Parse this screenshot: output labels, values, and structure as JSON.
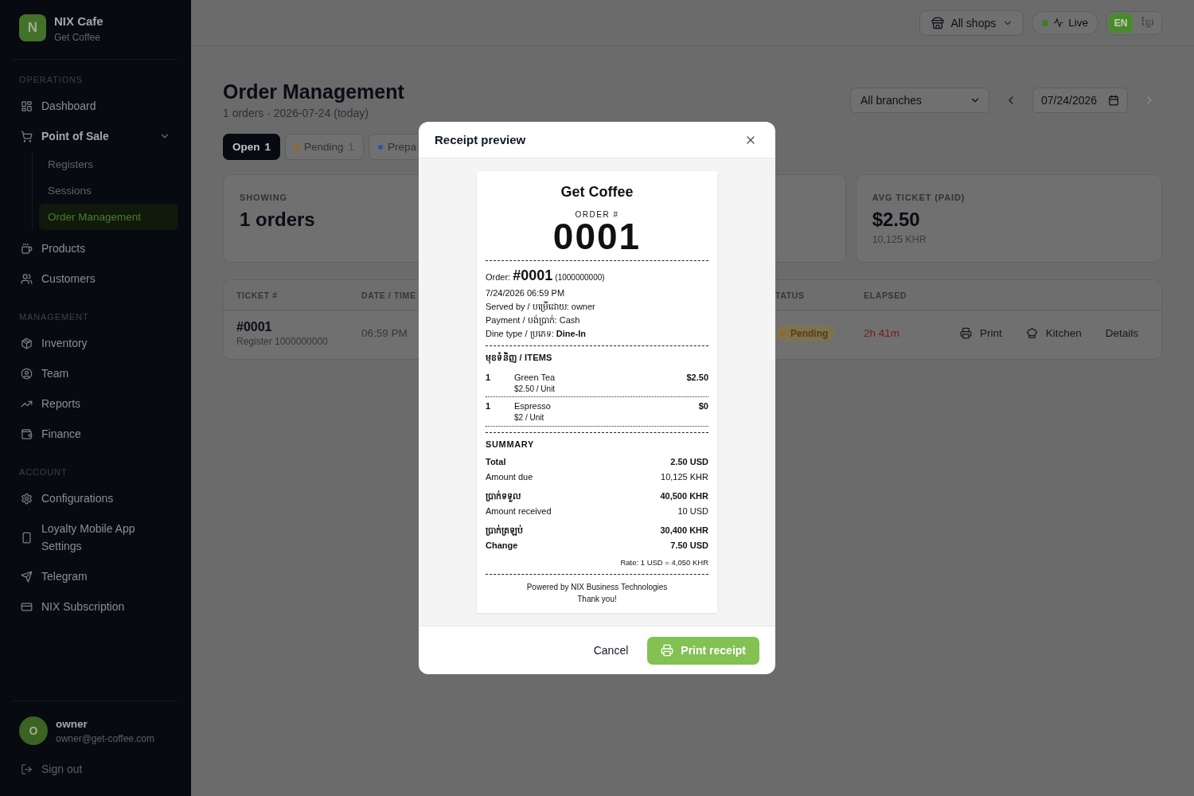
{
  "sidebar": {
    "brand": {
      "initial": "N",
      "name": "NIX Cafe",
      "subtitle": "Get Coffee"
    },
    "sections": [
      {
        "title": "OPERATIONS",
        "items": [
          {
            "label": "Dashboard",
            "selected": false
          },
          {
            "label": "Point of Sale",
            "selected": false,
            "expanded": true,
            "children": [
              {
                "label": "Registers",
                "selected": false
              },
              {
                "label": "Sessions",
                "selected": false
              },
              {
                "label": "Order Management",
                "selected": true
              }
            ]
          },
          {
            "label": "Products",
            "selected": false
          },
          {
            "label": "Customers",
            "selected": false
          }
        ]
      },
      {
        "title": "MANAGEMENT",
        "items": [
          {
            "label": "Inventory",
            "selected": false
          },
          {
            "label": "Team",
            "selected": false
          },
          {
            "label": "Reports",
            "selected": false
          },
          {
            "label": "Finance",
            "selected": false
          }
        ]
      },
      {
        "title": "ACCOUNT",
        "items": [
          {
            "label": "Configurations",
            "selected": false
          },
          {
            "label": "Loyalty Mobile App Settings",
            "selected": false
          },
          {
            "label": "Telegram",
            "selected": false
          },
          {
            "label": "NIX Subscription",
            "selected": false
          }
        ]
      }
    ],
    "user": {
      "initial": "O",
      "name": "owner",
      "email": "owner@get-coffee.com"
    },
    "sign_out": "Sign out"
  },
  "topbar": {
    "shop_selector": "All shops",
    "live": {
      "label": "Live",
      "on": true
    },
    "languages": [
      {
        "label": "EN",
        "selected": true
      },
      {
        "label": "ខ្មែរ",
        "selected": false
      }
    ]
  },
  "page": {
    "title": "Order Management",
    "subtitle": "1 orders · 2026-07-24 (today)",
    "branch_select": "All branches",
    "date": "07/24/2026",
    "prev_day": {
      "disabled": false
    },
    "next_day": {
      "disabled": true
    }
  },
  "tabs": [
    {
      "label": "Open",
      "count": "1",
      "selected": true
    },
    {
      "label": "Pending",
      "count": "1",
      "selected": false,
      "color": "#a0660f"
    },
    {
      "label": "Prepa",
      "selected": false,
      "color": "#2b55a6"
    }
  ],
  "stat_cards": [
    {
      "label": "SHOWING",
      "value": "1 orders"
    },
    {
      "label": "AVG TICKET (PAID)",
      "value": "$2.50",
      "sub": "10,125 KHR"
    }
  ],
  "table": {
    "columns": [
      "TICKET #",
      "DATE / TIME",
      "TATUS",
      "ELAPSED"
    ],
    "rows": [
      {
        "ticket": "#0001",
        "register": "Register 1000000000",
        "time": "06:59 PM",
        "status": {
          "label": "Pending",
          "color": "#a0660f"
        },
        "elapsed": "2h 41m",
        "actions": [
          {
            "label": "Print"
          },
          {
            "label": "Kitchen"
          },
          {
            "label": "Details"
          }
        ]
      }
    ]
  },
  "dialog": {
    "title": "Receipt preview",
    "receipt": {
      "store_name": "Get Coffee",
      "order_caption": "ORDER #",
      "order_number": "0001",
      "order_line": {
        "label": "Order:",
        "number": "#0001",
        "register": "(1000000000)"
      },
      "info_lines": [
        "7/24/2026 06:59 PM",
        "Served by / បម្រើដោយ: owner",
        "Payment / បង់ប្រាក់: Cash",
        "Dine type / ប្រភេទ: **Dine-In**"
      ],
      "items_title": "មុខទំនិញ / ITEMS",
      "items": [
        {
          "qty": "1",
          "name": "Green Tea",
          "unit_price": "$2.50 / Unit",
          "price": "$2.50"
        },
        {
          "qty": "1",
          "name": "Espresso",
          "unit_price": "$2 / Unit",
          "price": "$0"
        }
      ],
      "summary_title": "SUMMARY",
      "summary_groups": [
        {
          "rows": [
            {
              "label": "Total",
              "value": "2.50 USD",
              "strong": true
            },
            {
              "label": "Amount due",
              "value": "10,125 KHR",
              "strong": false
            }
          ]
        },
        {
          "rows": [
            {
              "label": "ប្រាក់ទទួល",
              "value": "40,500 KHR",
              "strong": true
            },
            {
              "label": "Amount received",
              "value": "10 USD",
              "strong": false
            }
          ]
        },
        {
          "rows": [
            {
              "label": "ប្រាក់ត្រឡប់",
              "value": "30,400 KHR",
              "strong": true
            },
            {
              "label": "Change",
              "value": "7.50 USD",
              "strong": true
            }
          ]
        }
      ],
      "rate": "Rate: 1 USD = 4,050 KHR",
      "footer": [
        "Powered by NIX Business Technologies",
        "Thank you!"
      ]
    },
    "cancel_button": "Cancel",
    "print_button": "Print receipt"
  }
}
